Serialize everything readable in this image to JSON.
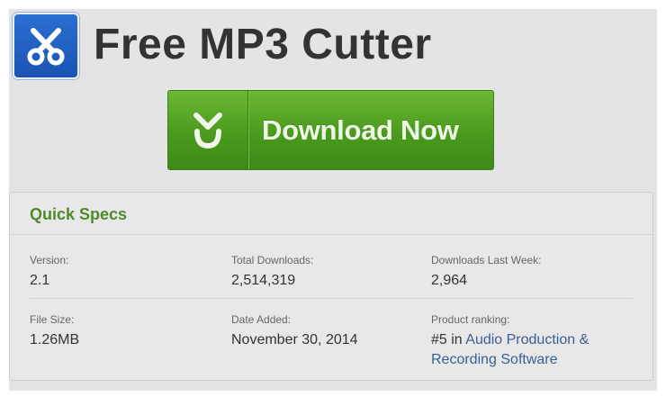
{
  "app": {
    "title": "Free MP3 Cutter"
  },
  "download_button": {
    "label": "Download Now"
  },
  "quick_specs": {
    "title": "Quick Specs",
    "version": {
      "label": "Version:",
      "value": "2.1"
    },
    "total_downloads": {
      "label": "Total Downloads:",
      "value": "2,514,319"
    },
    "downloads_last_week": {
      "label": "Downloads Last Week:",
      "value": "2,964"
    },
    "file_size": {
      "label": "File Size:",
      "value": "1.26MB"
    },
    "date_added": {
      "label": "Date Added:",
      "value": "November 30, 2014"
    },
    "product_ranking": {
      "label": "Product ranking:",
      "rank": "#5 in ",
      "category_link": "Audio Production & Recording Software"
    }
  },
  "icons": {
    "app_icon": "scissors-icon",
    "download_icon": "chevron-down-icon"
  },
  "colors": {
    "app_icon_bg": "#1f5fc4",
    "button_green": "#4a9a1e",
    "specs_title": "#4e8a2b",
    "link": "#3a5f94"
  }
}
